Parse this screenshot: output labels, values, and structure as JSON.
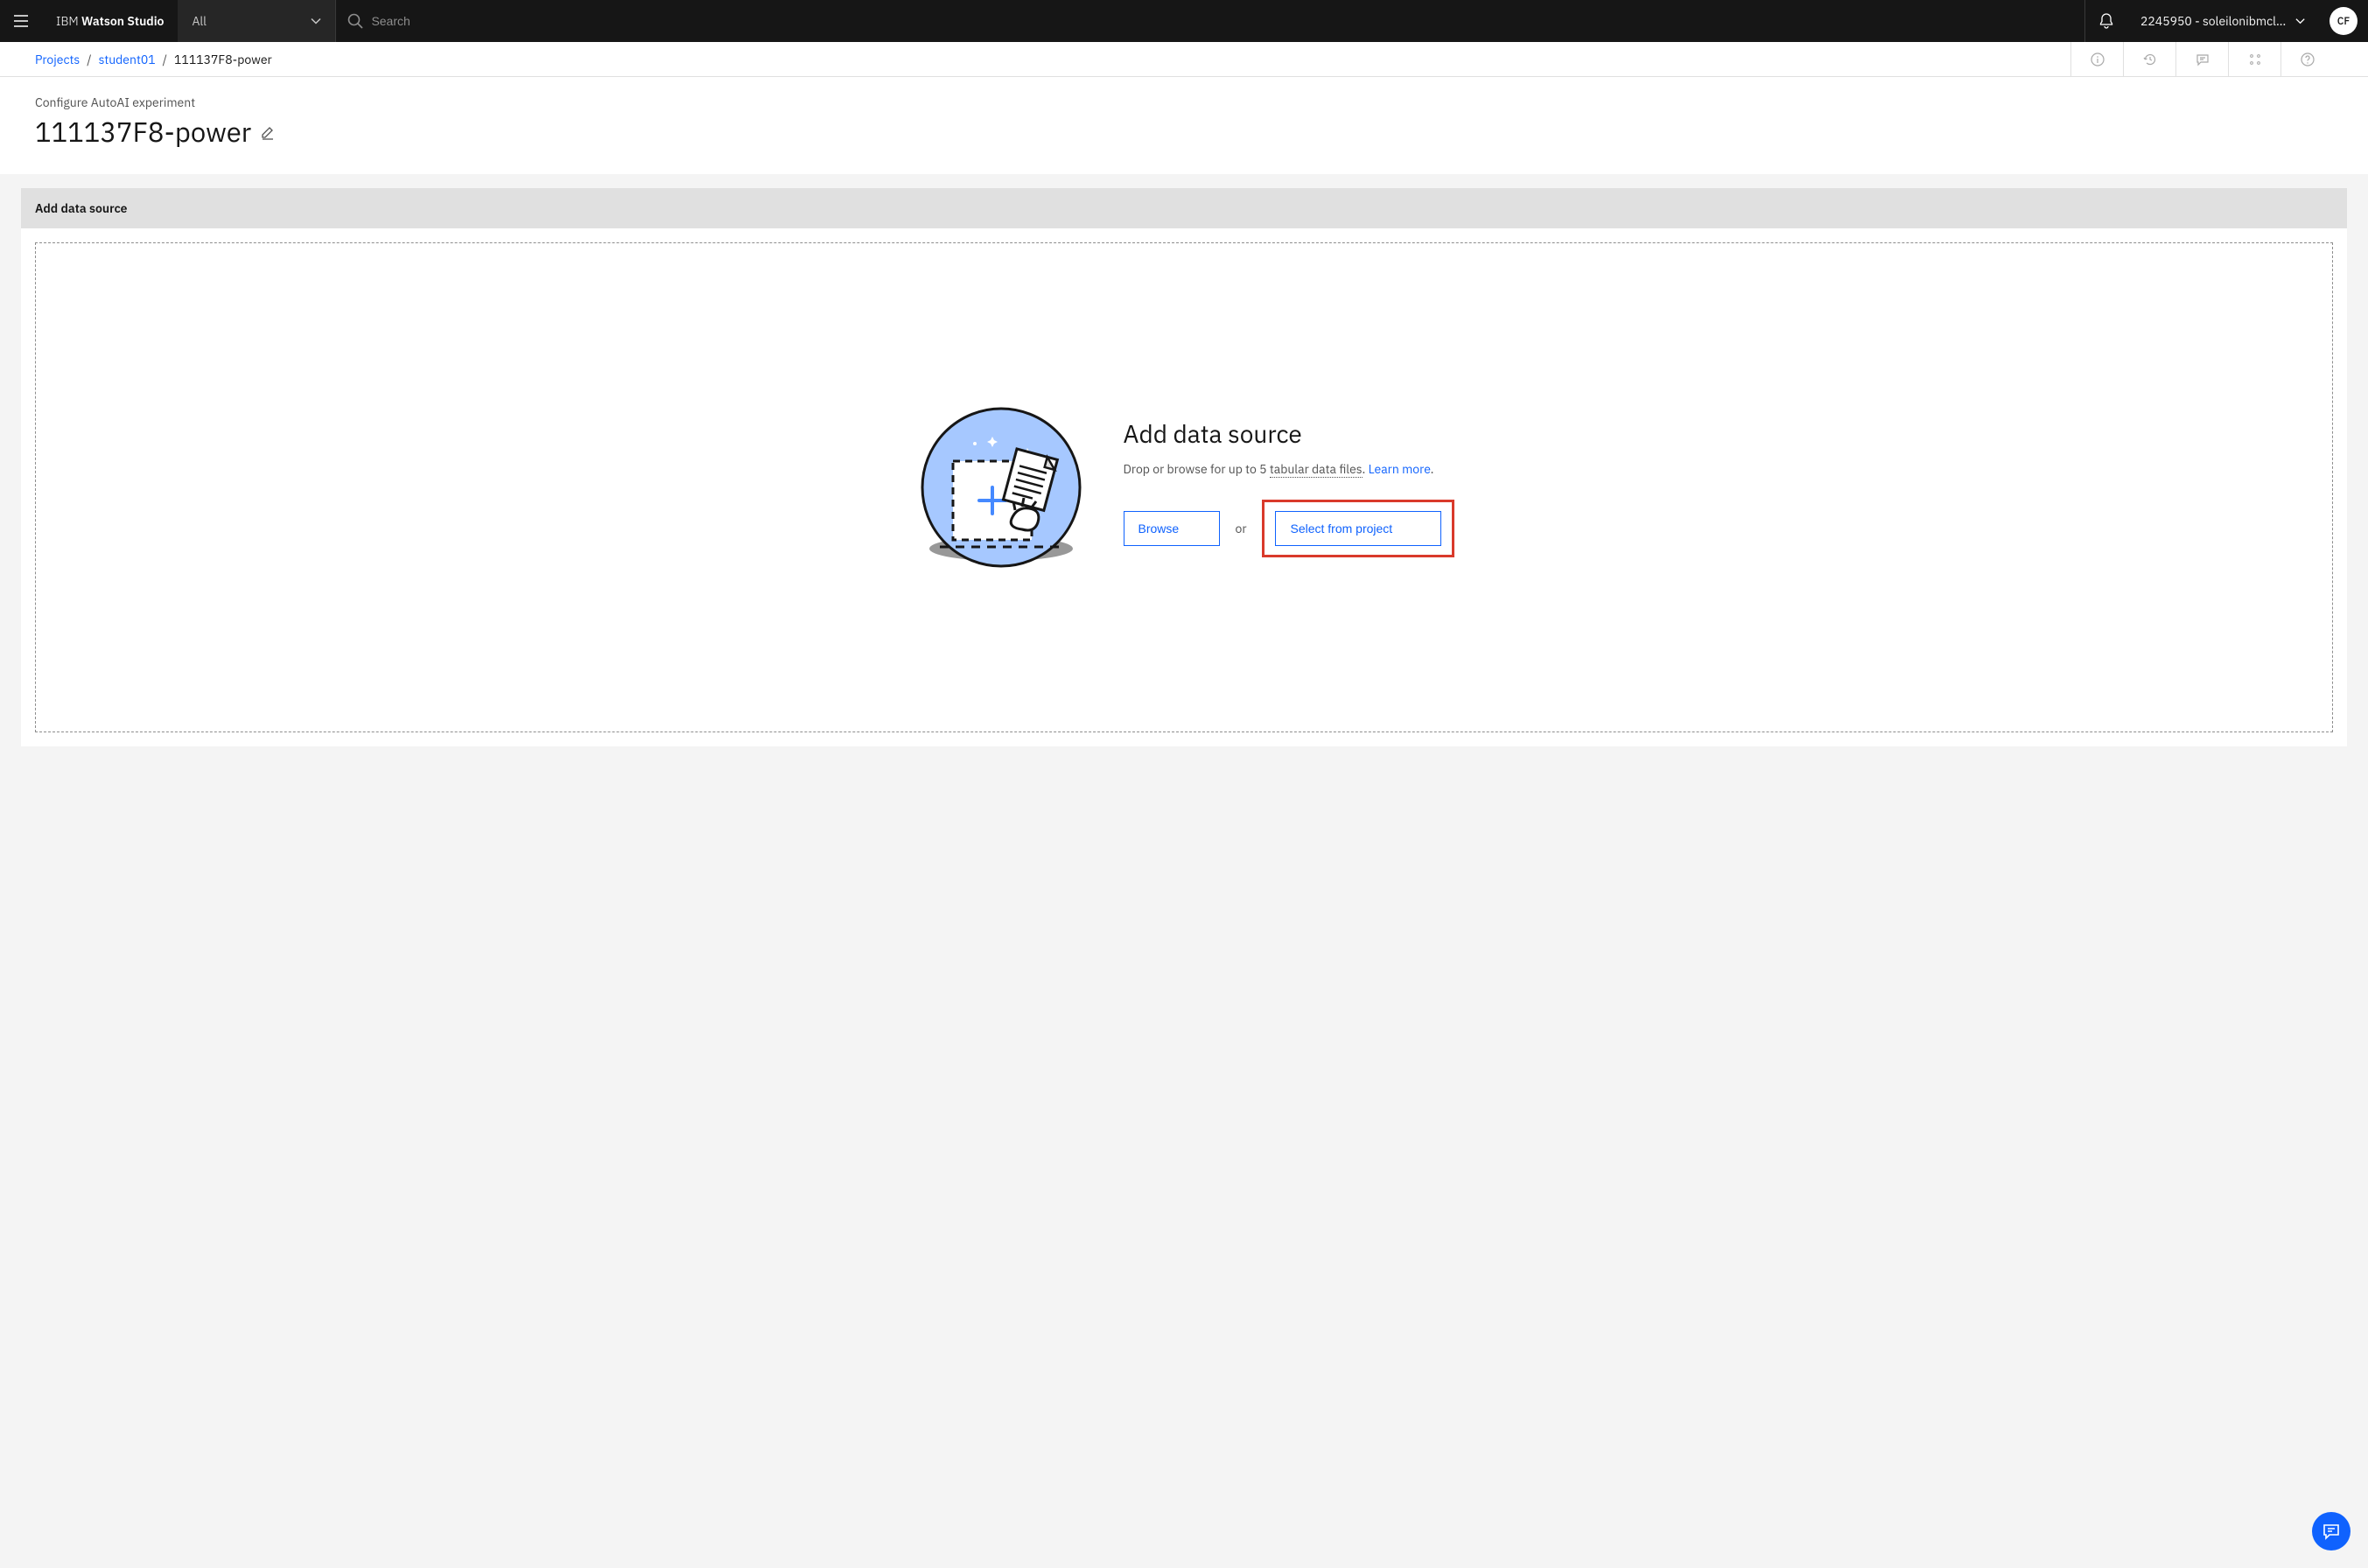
{
  "header": {
    "brand_thin": "IBM ",
    "brand_bold": "Watson Studio",
    "scope": "All",
    "search_placeholder": "Search",
    "account": "2245950 - soleilonibmclou...",
    "avatar_initials": "CF"
  },
  "breadcrumb": {
    "projects": "Projects",
    "student": "student01",
    "current": "111137F8-power"
  },
  "page": {
    "subtitle": "Configure AutoAI experiment",
    "title": "111137F8-power"
  },
  "panel": {
    "header": "Add data source",
    "dz_title": "Add data source",
    "dz_desc_prefix": "Drop or browse for up to 5 ",
    "dz_desc_underline": "tabular data files",
    "dz_desc_suffix": ". ",
    "dz_learn_more": "Learn more",
    "dz_desc_end": ".",
    "browse": "Browse",
    "or": "or",
    "select_from_project": "Select from project"
  }
}
